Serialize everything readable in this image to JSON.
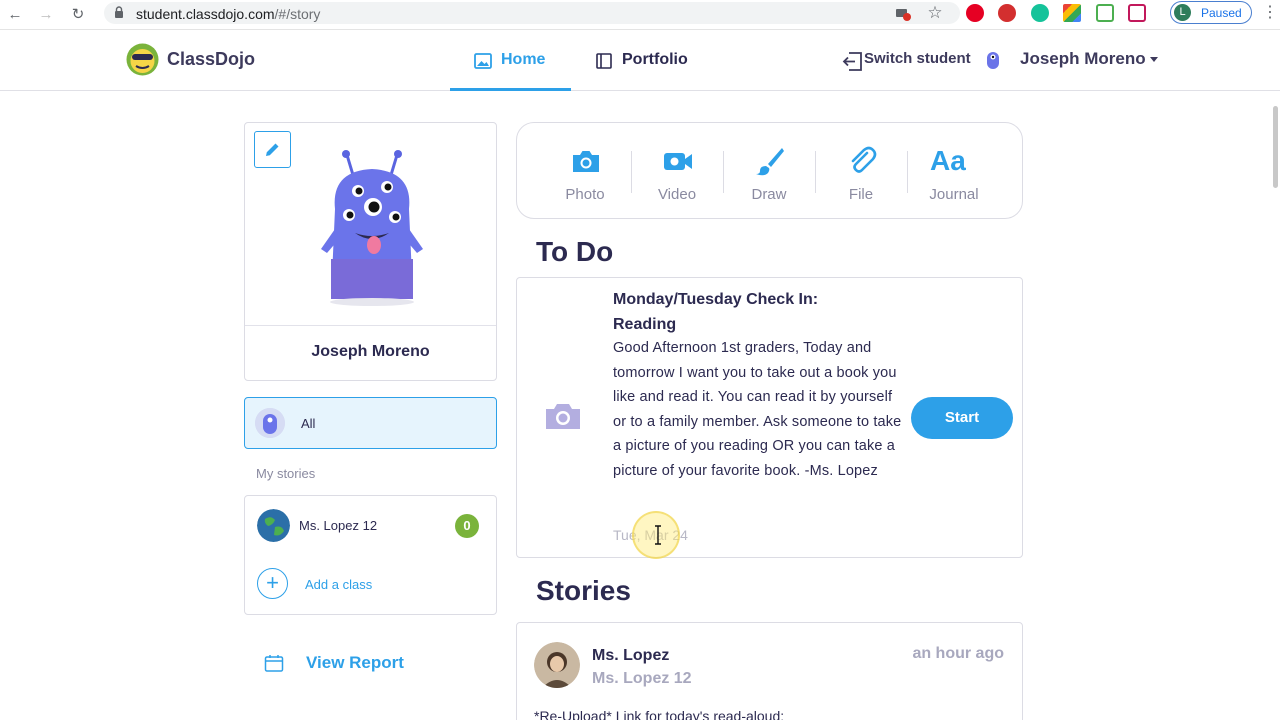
{
  "browser": {
    "url_host": "student.classdojo.com",
    "url_path": "/#/story",
    "profile_initial": "L",
    "profile_status": "Paused"
  },
  "header": {
    "brand": "ClassDojo",
    "tabs": [
      {
        "label": "Home",
        "active": true
      },
      {
        "label": "Portfolio",
        "active": false
      }
    ],
    "switch_student": "Switch student",
    "user_name": "Joseph Moreno"
  },
  "sidebar": {
    "profile_name": "Joseph Moreno",
    "all_label": "All",
    "my_stories_label": "My stories",
    "classes": [
      {
        "name": "Ms. Lopez 12",
        "count": "0"
      }
    ],
    "add_class": "Add a class",
    "view_report": "View Report"
  },
  "composer": {
    "items": [
      {
        "label": "Photo",
        "icon": "camera-icon"
      },
      {
        "label": "Video",
        "icon": "video-icon"
      },
      {
        "label": "Draw",
        "icon": "brush-icon"
      },
      {
        "label": "File",
        "icon": "paperclip-icon"
      },
      {
        "label": "Journal",
        "icon": "text-icon",
        "glyph": "Aa"
      }
    ]
  },
  "todo": {
    "heading": "To Do",
    "title": "Monday/Tuesday Check In: Reading",
    "body": "Good Afternoon 1st graders, Today and tomorrow I want you to take out a book you like and read it. You can read it by yourself or to a family member. Ask someone to take a picture of you reading OR you can take a picture of your favorite book. -Ms. Lopez",
    "date": "Tue, Mar 24",
    "start_label": "Start"
  },
  "stories": {
    "heading": "Stories",
    "items": [
      {
        "author": "Ms. Lopez",
        "class_name": "Ms. Lopez 12",
        "time": "an hour ago",
        "text": "*Re-Upload* Link for today's read-aloud:"
      }
    ]
  },
  "colors": {
    "accent": "#2da0e8",
    "text": "#2c2a50",
    "muted": "#a8a8be",
    "count_badge": "#7ab33b"
  }
}
